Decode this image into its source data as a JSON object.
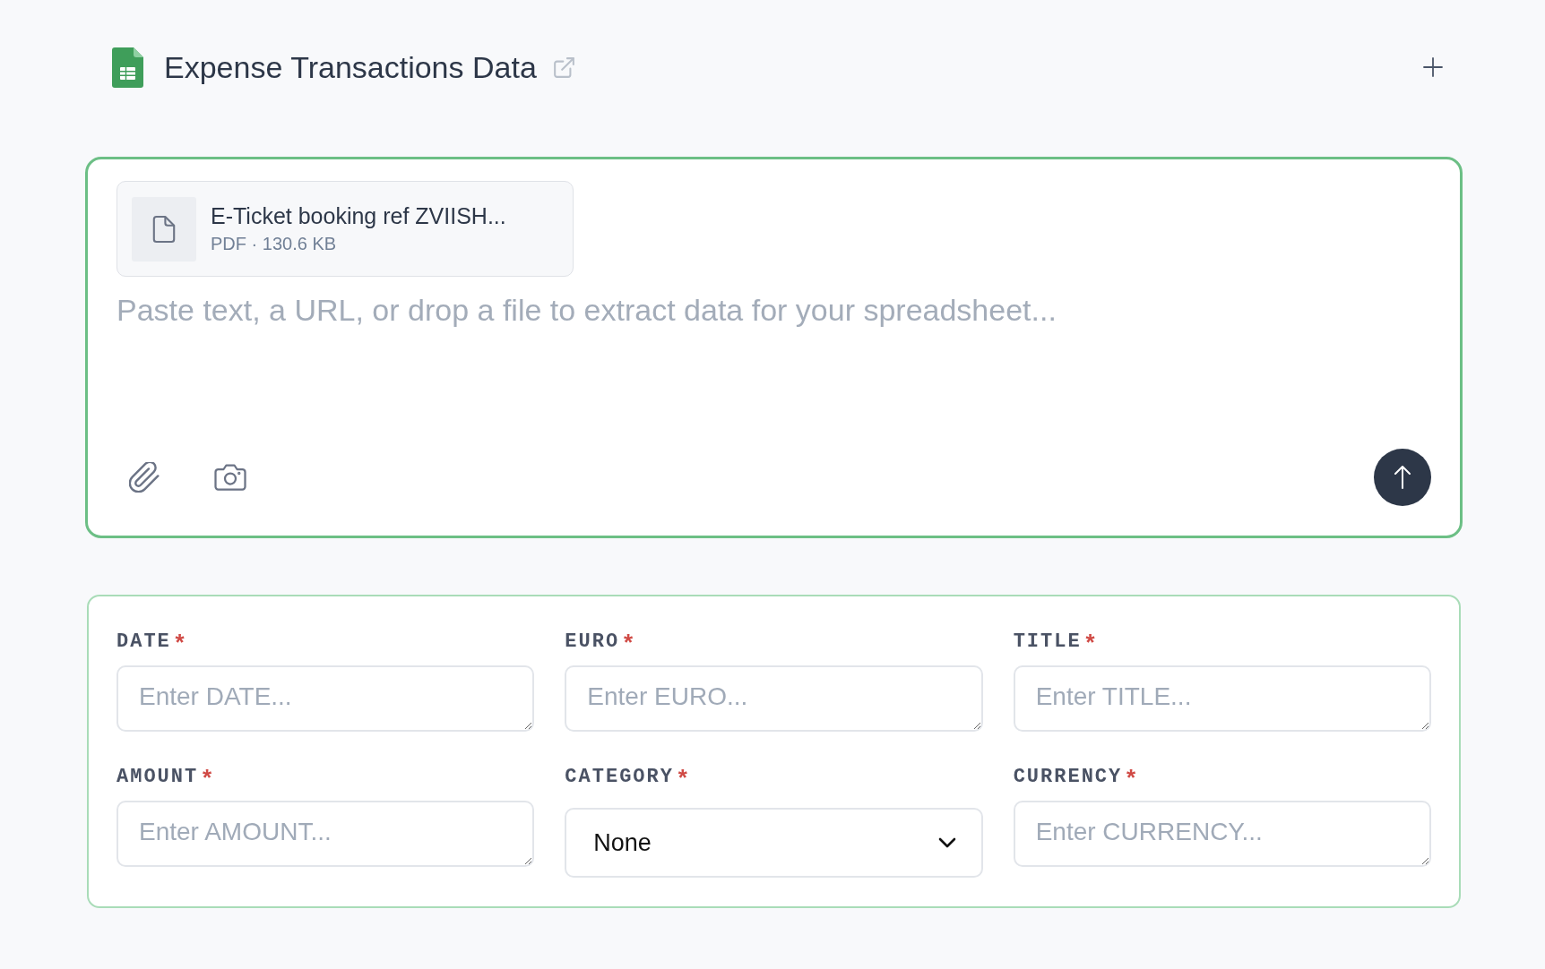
{
  "header": {
    "title": "Expense Transactions Data"
  },
  "composer": {
    "attachments": [
      {
        "name": "E-Ticket booking ref ZVIISH...",
        "meta": "PDF · 130.6 KB"
      }
    ],
    "placeholder": "Paste text, a URL, or drop a file to extract data for your spreadsheet..."
  },
  "form": {
    "required_mark": "*",
    "fields": [
      {
        "label": "DATE",
        "required": true,
        "kind": "text",
        "placeholder": "Enter DATE..."
      },
      {
        "label": "EURO",
        "required": true,
        "kind": "text",
        "placeholder": "Enter EURO..."
      },
      {
        "label": "TITLE",
        "required": true,
        "kind": "text",
        "placeholder": "Enter TITLE..."
      },
      {
        "label": "AMOUNT",
        "required": true,
        "kind": "text",
        "placeholder": "Enter AMOUNT..."
      },
      {
        "label": "CATEGORY",
        "required": true,
        "kind": "select",
        "value": "None"
      },
      {
        "label": "CURRENCY",
        "required": true,
        "kind": "text",
        "placeholder": "Enter CURRENCY..."
      }
    ]
  }
}
